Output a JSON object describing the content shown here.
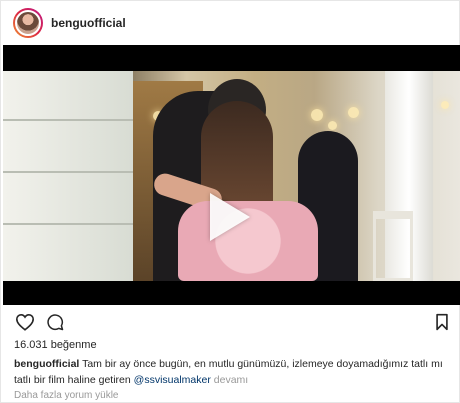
{
  "post": {
    "username": "benguofficial",
    "likes": "16.031 beğenme",
    "caption": {
      "username": "benguofficial",
      "text_before_tag": "Tam bir ay önce bugün, en mutlu günümüzü, izlemeye doyamadığımız tatlı mı tatlı bir film haline getiren",
      "tag": "@ssvisualmaker",
      "more": "devamı"
    },
    "view_comments": "Daha fazla yorum yükle"
  },
  "icons": {
    "avatar": "profile-avatar",
    "play": "play-icon",
    "like": "heart-icon",
    "comment": "comment-icon",
    "save": "bookmark-icon"
  }
}
